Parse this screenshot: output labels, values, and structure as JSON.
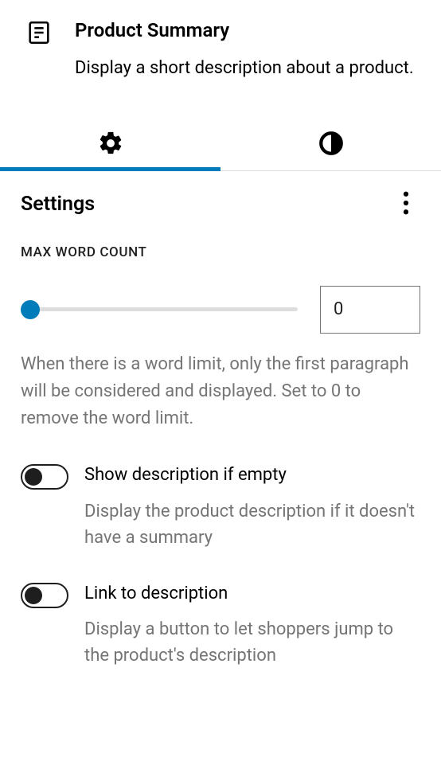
{
  "header": {
    "title": "Product Summary",
    "description": "Display a short description about a product."
  },
  "panel": {
    "title": "Settings",
    "field_label": "Max word count",
    "slider_value": "0",
    "help_text": "When there is a word limit, only the first paragraph will be considered and displayed. Set to 0 to remove the word limit."
  },
  "toggles": [
    {
      "label": "Show description if empty",
      "help": "Display the product description if it doesn't have a summary"
    },
    {
      "label": "Link to description",
      "help": "Display a button to let shoppers jump to the product's description"
    }
  ]
}
